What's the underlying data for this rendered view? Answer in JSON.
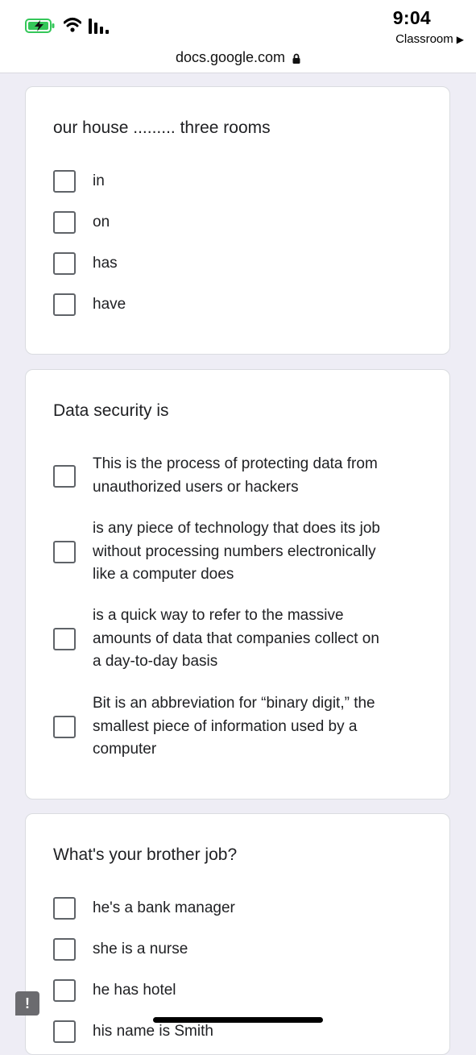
{
  "status": {
    "time": "9:04",
    "back_app": "Classroom",
    "url": "docs.google.com",
    "icons": [
      "battery-charging-icon",
      "wifi-icon",
      "signal-icon",
      "lock-icon"
    ]
  },
  "questions": [
    {
      "title": "our house ......... three rooms",
      "options": [
        "in",
        "on",
        "has",
        "have"
      ]
    },
    {
      "title": "Data security is",
      "options": [
        "This is the process of protecting data from\nunauthorized users or hackers",
        "is any piece of technology that does its job\nwithout processing numbers electronically\nlike a computer does",
        "is a quick way to refer to the massive\namounts of data that companies collect on\na day-to-day basis",
        "Bit is an abbreviation for “binary digit,” the\nsmallest piece of information used by a\ncomputer"
      ]
    },
    {
      "title": "What's your brother job?",
      "options": [
        "he's a bank manager",
        "she is a nurse",
        "he has hotel",
        "his name is Smith"
      ]
    }
  ],
  "colors": {
    "page_background": "#eeedf5",
    "card_background": "#ffffff",
    "checkbox_border": "#5f6368",
    "battery_green": "#34c759"
  }
}
